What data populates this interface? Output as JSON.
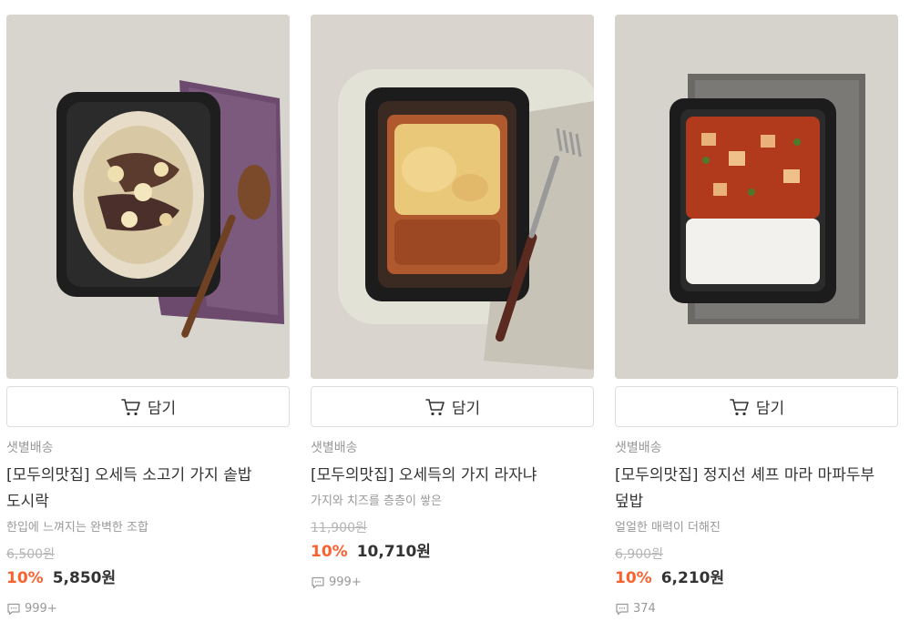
{
  "cart_label": "담기",
  "colors": {
    "discount": "#fa622f",
    "muted": "#999999",
    "border": "#dddddd"
  },
  "products": [
    {
      "delivery": "샛별배송",
      "name": "[모두의맛집] 오세득 소고기 가지 솥밥 도시락",
      "description": "한입에 느껴지는 완벽한 조합",
      "original_price": "6,500원",
      "discount": "10%",
      "price": "5,850원",
      "reviews": "999+",
      "image": "eggplant-beef-rice-bowl"
    },
    {
      "delivery": "샛별배송",
      "name": "[모두의맛집] 오세득의 가지 라자냐",
      "description": "가지와 치즈를 층층이 쌓은",
      "original_price": "11,900원",
      "discount": "10%",
      "price": "10,710원",
      "reviews": "999+",
      "image": "eggplant-lasagna"
    },
    {
      "delivery": "샛별배송",
      "name": "[모두의맛집] 정지선 셰프 마라 마파두부 덮밥",
      "description": "얼얼한 매력이 더해진",
      "original_price": "6,900원",
      "discount": "10%",
      "price": "6,210원",
      "reviews": "374",
      "image": "mala-mapo-tofu-rice"
    }
  ]
}
